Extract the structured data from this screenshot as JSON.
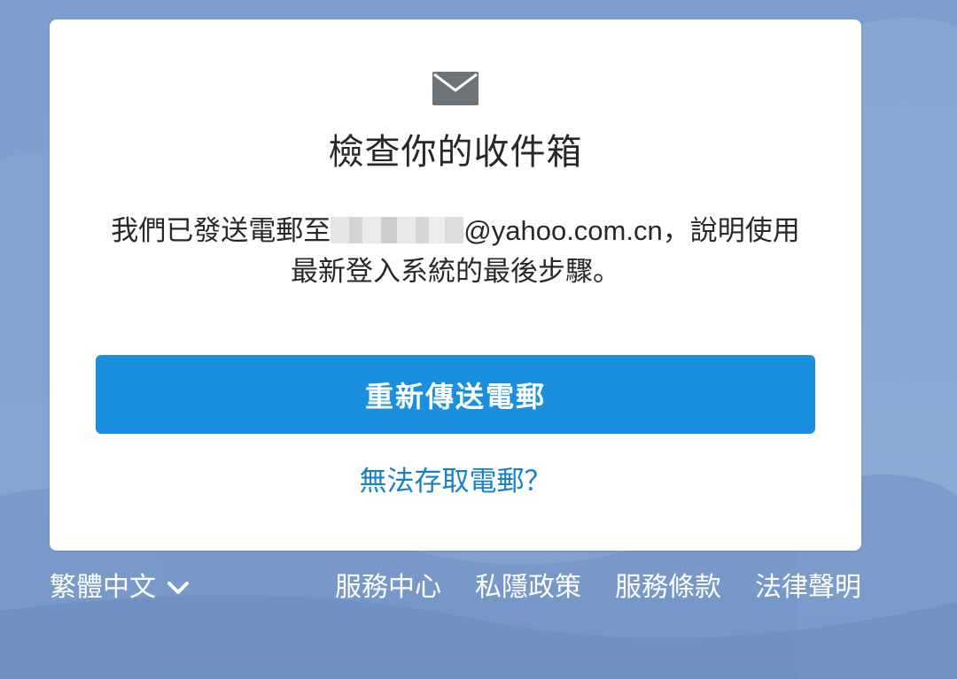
{
  "card": {
    "icon": "mail-icon",
    "title": "檢查你的收件箱",
    "message_before": "我們已發送電郵至",
    "email_domain": "@yahoo.com.cn",
    "message_after": "，說明使用最新登入系統的最後步驟。",
    "resend_button": "重新傳送電郵",
    "help_link": "無法存取電郵？"
  },
  "footer": {
    "language": "繁體中文",
    "language_icon": "chevron-down-icon",
    "links": [
      "服務中心",
      "私隱政策",
      "服務條款",
      "法律聲明"
    ]
  },
  "colors": {
    "button": "#1a8fdd",
    "link": "#1681c4",
    "icon": "#6e7378",
    "background": "#7d9fcf"
  }
}
